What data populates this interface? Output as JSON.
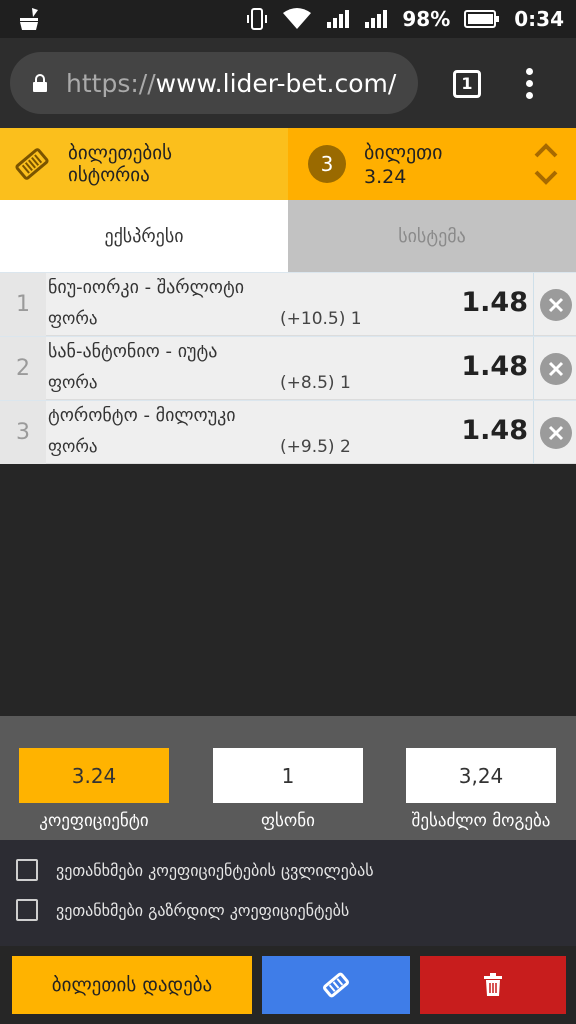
{
  "status_bar": {
    "battery_percent": "98%",
    "time": "0:34"
  },
  "browser": {
    "url_protocol": "https://",
    "url_host": "www.lider-bet.com/",
    "tab_count": "1"
  },
  "ticket_header": {
    "history_label": "ბილეთების ისტორია",
    "bet_count": "3",
    "ticket_title": "ბილეთი",
    "ticket_odds": "3.24"
  },
  "tabs": [
    {
      "label": "ექსპრესი",
      "active": true
    },
    {
      "label": "სისტემა",
      "active": false
    }
  ],
  "bets": [
    {
      "num": "1",
      "match": "ნიუ-იორკი - შარლოტი",
      "market": "ფორა",
      "line": "(+10.5) 1",
      "odds": "1.48"
    },
    {
      "num": "2",
      "match": "სან-ანტონიო - იუტა",
      "market": "ფორა",
      "line": "(+8.5) 1",
      "odds": "1.48"
    },
    {
      "num": "3",
      "match": "ტორონტო - მილოუკი",
      "market": "ფორა",
      "line": "(+9.5) 2",
      "odds": "1.48"
    }
  ],
  "summary": {
    "coefficient_value": "3.24",
    "coefficient_label": "კოეფიციენტი",
    "stake_value": "1",
    "stake_label": "ფსონი",
    "payout_value": "3,24",
    "payout_label": "შესაძლო მოგება"
  },
  "agreements": [
    {
      "label": "ვეთანხმები კოეფიციენტების ცვლილებას",
      "checked": false
    },
    {
      "label": "ვეთანხმები გაზრდილ კოეფიციენტებს",
      "checked": false
    }
  ],
  "actions": {
    "place_label": "ბილეთის დადება",
    "edit_icon": "ticket-icon",
    "delete_icon": "trash-icon"
  },
  "colors": {
    "accent": "#ffb300",
    "edit": "#3f7de8",
    "delete": "#c81d1d"
  }
}
